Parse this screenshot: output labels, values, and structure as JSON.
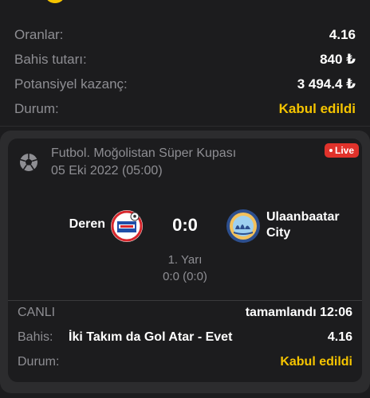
{
  "summary": {
    "odds_label": "Oranlar:",
    "odds_value": "4.16",
    "stake_label": "Bahis tutarı:",
    "stake_value": "840 ₺",
    "potential_label": "Potansiyel kazanç:",
    "potential_value": "3 494.4 ₺",
    "status_label": "Durum:",
    "status_value": "Kabul edildi"
  },
  "event": {
    "league": "Futbol. Moğolistan Süper Kupası",
    "date": "05 Eki 2022 (05:00)",
    "live_badge": "Live",
    "home_team": "Deren",
    "away_team": "Ulaanbaatar City",
    "score": "0:0",
    "period": "1. Yarı",
    "period_score": "0:0 (0:0)"
  },
  "bet": {
    "state_label": "CANLI",
    "state_value": "tamamlandı 12:06",
    "bet_label": "Bahis:",
    "market": "İki Takım da Gol Atar - Evet",
    "odds": "4.16",
    "status_label": "Durum:",
    "status_value": "Kabul edildi"
  },
  "colors": {
    "accent": "#f5c400",
    "live": "#e0322b",
    "muted": "#8e8e93",
    "background": "#1c1c1e"
  },
  "icons": {
    "sport": "soccer-ball-icon",
    "home_logo": "deren-club-logo",
    "away_logo": "ulaanbaatar-city-logo"
  }
}
